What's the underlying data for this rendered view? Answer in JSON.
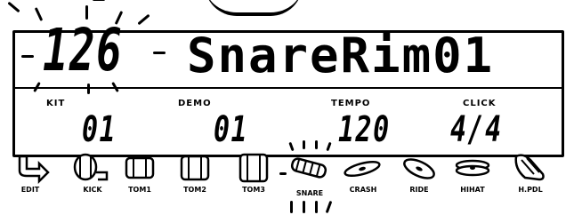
{
  "display": {
    "kit_number": "126",
    "voice_name": "SnareRim01",
    "kit_label": "KIT",
    "kit_value": "01",
    "demo_label": "DEMO",
    "demo_value": "01",
    "tempo_label": "TEMPO",
    "tempo_value": "120",
    "click_label": "CLICK",
    "click_value": "4/4"
  },
  "pads": [
    {
      "label": "EDIT",
      "icon": "edit-arrow-icon"
    },
    {
      "label": "KICK",
      "icon": "kick-drum-icon"
    },
    {
      "label": "TOM1",
      "icon": "tom-drum-icon"
    },
    {
      "label": "TOM2",
      "icon": "tom-drum-icon"
    },
    {
      "label": "TOM3",
      "icon": "tom-drum-icon"
    },
    {
      "label": "SNARE",
      "icon": "snare-drum-icon"
    },
    {
      "label": "CRASH",
      "icon": "crash-cymbal-icon"
    },
    {
      "label": "RIDE",
      "icon": "ride-cymbal-icon"
    },
    {
      "label": "HIHAT",
      "icon": "hihat-icon"
    },
    {
      "label": "H.PDL",
      "icon": "pedal-icon"
    }
  ]
}
